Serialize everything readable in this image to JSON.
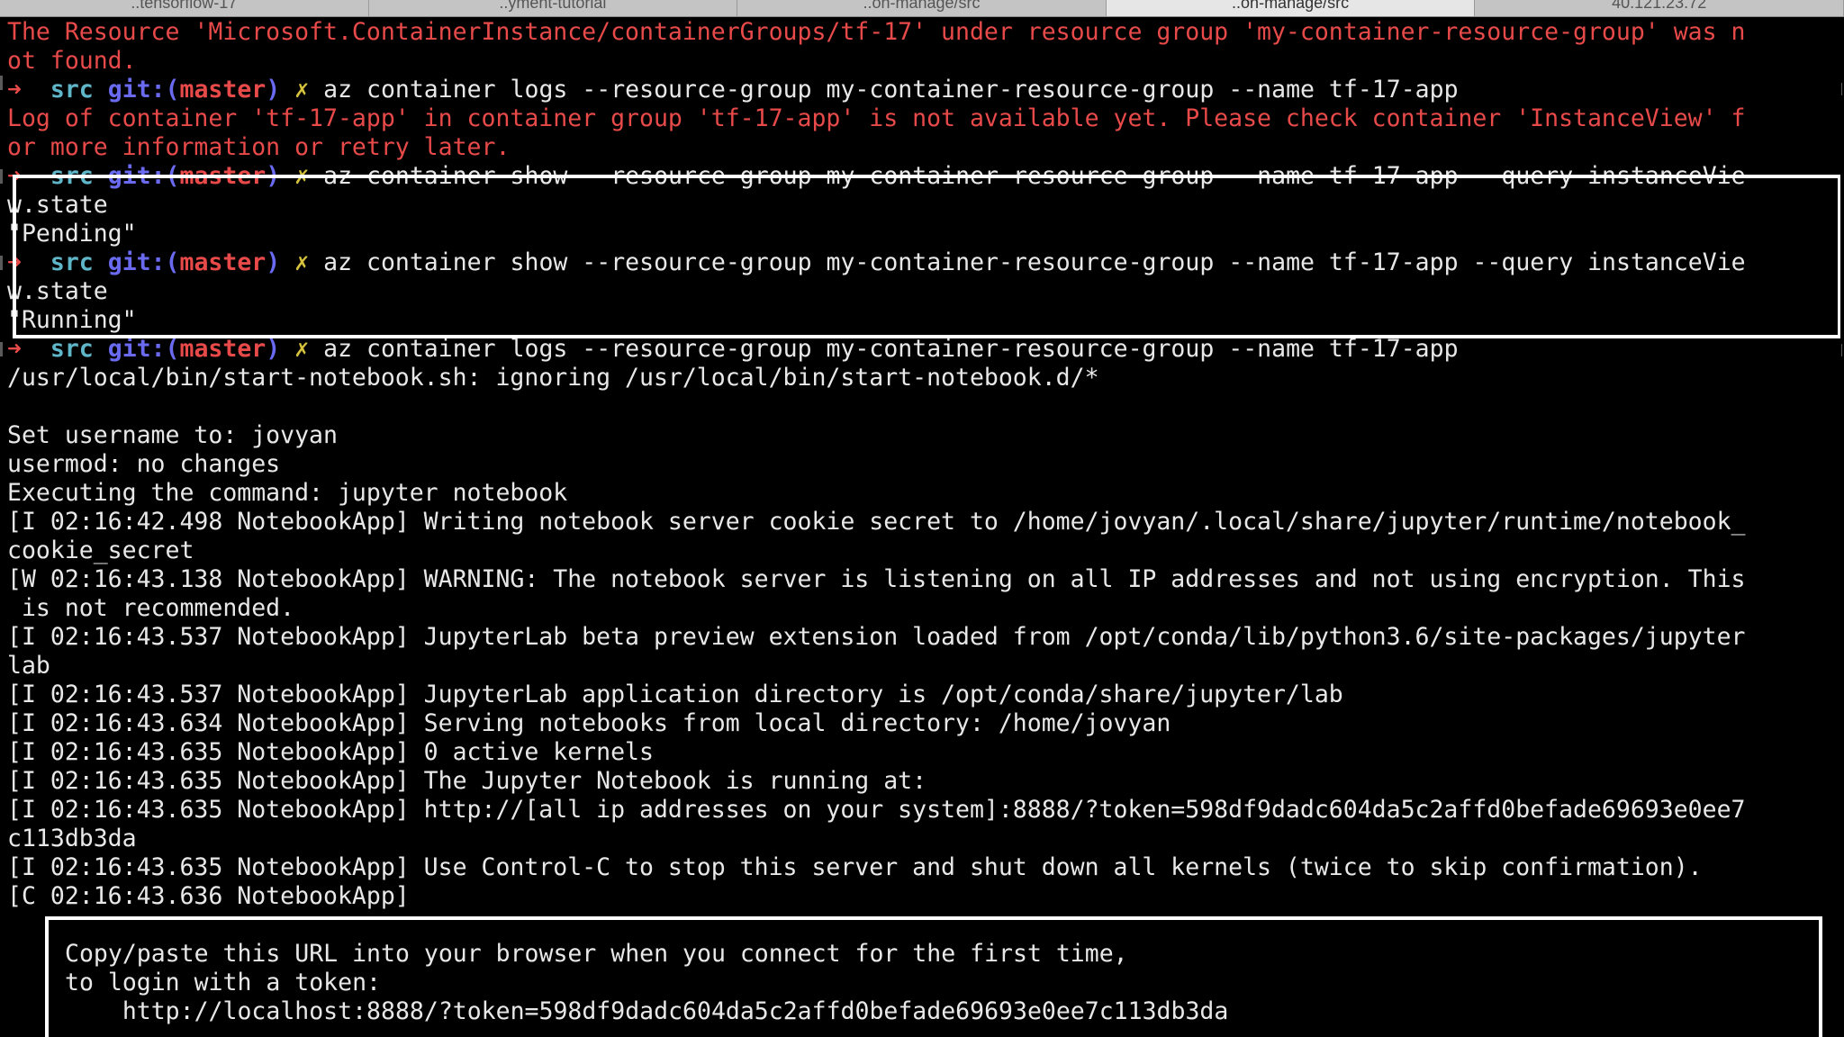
{
  "tabs": [
    {
      "label": "..tensorflow-17",
      "active": false
    },
    {
      "label": "..yment-tutorial",
      "active": false
    },
    {
      "label": "..on-manage/src",
      "active": false
    },
    {
      "label": "..on-manage/src",
      "active": true
    },
    {
      "label": "40.121.23.72",
      "active": false
    }
  ],
  "prompt": {
    "arrow": "➜",
    "dir": "src",
    "git_prefix": "git:(",
    "branch": "master",
    "git_suffix": ")",
    "dirty": "✗"
  },
  "lines": {
    "l0": "The Resource 'Microsoft.ContainerInstance/containerGroups/tf-17' under resource group 'my-container-resource-group' was n",
    "l1": "ot found.",
    "l2_cmd": "az container logs --resource-group my-container-resource-group --name tf-17-app",
    "l3": "Log of container 'tf-17-app' in container group 'tf-17-app' is not available yet. Please check container 'InstanceView' f",
    "l4": "or more information or retry later.",
    "l5_cmd": "az container show --resource-group my-container-resource-group --name tf-17-app --query instanceVie",
    "l6": "w.state",
    "l7": "\"Pending\"",
    "l8_cmd": "az container show --resource-group my-container-resource-group --name tf-17-app --query instanceVie",
    "l9": "w.state",
    "l10": "\"Running\"",
    "l11_cmd": "az container logs --resource-group my-container-resource-group --name tf-17-app",
    "l12": "/usr/local/bin/start-notebook.sh: ignoring /usr/local/bin/start-notebook.d/*",
    "l13": "",
    "l14": "Set username to: jovyan",
    "l15": "usermod: no changes",
    "l16": "Executing the command: jupyter notebook",
    "l17": "[I 02:16:42.498 NotebookApp] Writing notebook server cookie secret to /home/jovyan/.local/share/jupyter/runtime/notebook_",
    "l18": "cookie_secret",
    "l19": "[W 02:16:43.138 NotebookApp] WARNING: The notebook server is listening on all IP addresses and not using encryption. This",
    "l20": " is not recommended.",
    "l21": "[I 02:16:43.537 NotebookApp] JupyterLab beta preview extension loaded from /opt/conda/lib/python3.6/site-packages/jupyter",
    "l22": "lab",
    "l23": "[I 02:16:43.537 NotebookApp] JupyterLab application directory is /opt/conda/share/jupyter/lab",
    "l24": "[I 02:16:43.634 NotebookApp] Serving notebooks from local directory: /home/jovyan",
    "l25": "[I 02:16:43.635 NotebookApp] 0 active kernels",
    "l26": "[I 02:16:43.635 NotebookApp] The Jupyter Notebook is running at:",
    "l27": "[I 02:16:43.635 NotebookApp] http://[all ip addresses on your system]:8888/?token=598df9dadc604da5c2affd0befade69693e0ee7",
    "l28": "c113db3da",
    "l29": "[I 02:16:43.635 NotebookApp] Use Control-C to stop this server and shut down all kernels (twice to skip confirmation).",
    "l30": "[C 02:16:43.636 NotebookApp]",
    "l31": "",
    "l32": "Copy/paste this URL into your browser when you connect for the first time,",
    "l33": "to login with a token:",
    "l34": "    http://localhost:8888/?token=598df9dadc604da5c2affd0befade69693e0ee7c113db3da"
  },
  "colors": {
    "background": "#000000",
    "error": "#e84a4a",
    "output": "#e8e8e8",
    "prompt_dir": "#5fb6c8",
    "prompt_git": "#6a6af0",
    "prompt_dirty": "#d6c23c",
    "highlight": "#ffffff"
  }
}
